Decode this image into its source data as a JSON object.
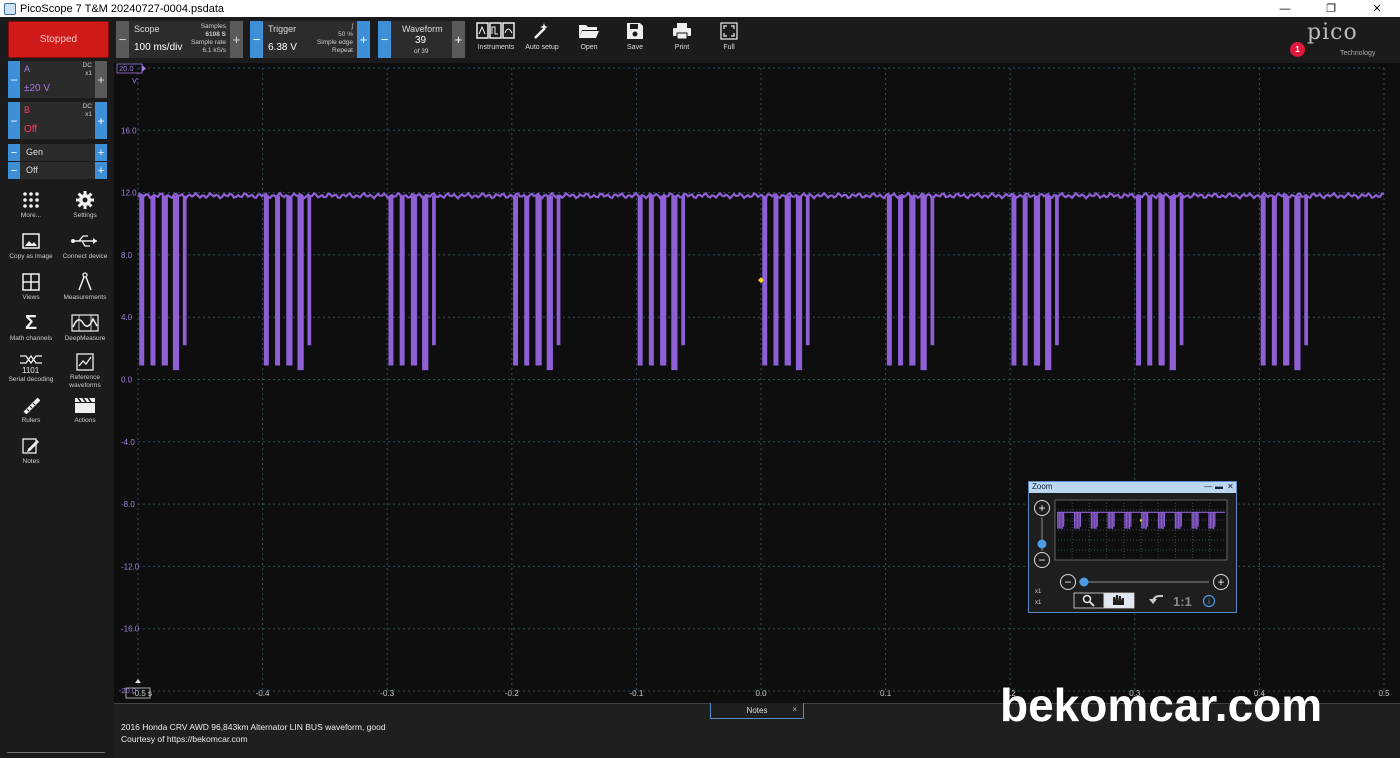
{
  "window": {
    "title": "PicoScope 7 T&M 20240727-0004.psdata",
    "controls": {
      "minimize": "—",
      "restore": "❐",
      "close": "✕"
    }
  },
  "toolbar": {
    "run_state": "Stopped",
    "scope": {
      "label": "Scope",
      "value": "100 ms/div",
      "samples_label": "Samples",
      "samples": "6108 S",
      "rate_label": "Sample rate",
      "rate": "6.1 kS/s"
    },
    "trigger": {
      "label": "Trigger",
      "value": "6.38 V",
      "pre": "50 %",
      "type": "Simple edge",
      "mode": "Repeat"
    },
    "waveform": {
      "label": "Waveform",
      "current": "39",
      "of": "of 39"
    },
    "tools": [
      {
        "id": "instruments",
        "label": "Instruments"
      },
      {
        "id": "auto-setup",
        "label": "Auto setup"
      },
      {
        "id": "open",
        "label": "Open"
      },
      {
        "id": "save",
        "label": "Save"
      },
      {
        "id": "print",
        "label": "Print"
      },
      {
        "id": "full",
        "label": "Full"
      }
    ],
    "logo": {
      "word": "pico",
      "sub": "Technology",
      "badge": "1"
    }
  },
  "channels": {
    "a": {
      "name": "A",
      "range": "±20 V",
      "coupling": "DC",
      "probe": "x1"
    },
    "b": {
      "name": "B",
      "range": "Off",
      "coupling": "DC",
      "probe": "x1"
    },
    "gen": {
      "name": "Gen",
      "state": "Off"
    }
  },
  "sidebar": [
    {
      "id": "more",
      "label": "More..."
    },
    {
      "id": "settings",
      "label": "Settings"
    },
    {
      "id": "copy-as-image",
      "label": "Copy as image"
    },
    {
      "id": "connect-device",
      "label": "Connect device"
    },
    {
      "id": "views",
      "label": "Views"
    },
    {
      "id": "measurements",
      "label": "Measurements"
    },
    {
      "id": "math-channels",
      "label": "Math channels"
    },
    {
      "id": "deepmeasure",
      "label": "DeepMeasure"
    },
    {
      "id": "serial-decoding",
      "label": "Serial decoding"
    },
    {
      "id": "reference-waveforms",
      "label": "Reference waveforms"
    },
    {
      "id": "rulers",
      "label": "Rulers"
    },
    {
      "id": "actions",
      "label": "Actions"
    },
    {
      "id": "notes",
      "label": "Notes"
    }
  ],
  "chart_data": {
    "type": "line",
    "xlim": [
      -0.5,
      0.5
    ],
    "ylim": [
      -20,
      20
    ],
    "x_ticks": [
      "-0.5 s",
      "-0.4",
      "-0.3",
      "-0.2",
      "-0.1",
      "0.0",
      "0.1",
      "0.2",
      "0.3",
      "0.4",
      "0.5"
    ],
    "y_ticks": [
      "20.0",
      "16.0",
      "12.0",
      "8.0",
      "4.0",
      "0.0",
      "-4.0",
      "-8.0",
      "-12.0",
      "-16.0",
      "-20.0"
    ],
    "y_unit": "V",
    "grid": true,
    "series": [
      {
        "color": "#8f5fd6",
        "idle_level": 11.8,
        "low_level": 0.8,
        "burst_start_times": [
          -0.5,
          -0.4,
          -0.3,
          -0.2,
          -0.1,
          0.0,
          0.1,
          0.2,
          0.3,
          0.4
        ],
        "burst_pulses": [
          {
            "t": 0.001,
            "w": 0.004,
            "low": 0.9
          },
          {
            "t": 0.01,
            "w": 0.004,
            "low": 0.9
          },
          {
            "t": 0.019,
            "w": 0.005,
            "low": 0.9
          },
          {
            "t": 0.028,
            "w": 0.005,
            "low": 0.6
          },
          {
            "t": 0.036,
            "w": 0.003,
            "low": 2.2
          }
        ]
      }
    ],
    "trigger_marker": {
      "x": 0.0,
      "y": 6.38,
      "color": "#f2d21c"
    }
  },
  "zoom_overview": {
    "title": "Zoom",
    "ratio": "1:1",
    "x_scale": "x1",
    "y_scale": "x1"
  },
  "notes": {
    "tab_label": "Notes",
    "close": "×",
    "lines": [
      "2016 Honda CRV AWD 96,843km Alternator LIN BUS waveform, good",
      "Courtesy of https://bekomcar.com"
    ]
  },
  "watermark": "bekomcar.com",
  "colors": {
    "channel_a": "#8f5fd6",
    "channel_b": "#ff3b66",
    "stop": "#d01a1a",
    "accent": "#3d8fd8"
  }
}
